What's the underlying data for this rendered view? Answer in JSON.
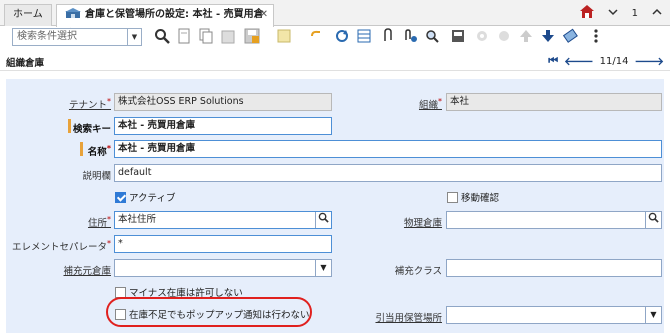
{
  "tabs": {
    "home": "ホーム",
    "active": "倉庫と保管場所の設定: 本社 - 売買用倉庫",
    "close": "✕"
  },
  "topright": {
    "count": "1",
    "menu": "⋮"
  },
  "toolbar": {
    "search_placeholder": "検索条件選択"
  },
  "section": {
    "title": "組織倉庫",
    "record_nav": "11/14"
  },
  "form": {
    "tenant_label": "テナント",
    "tenant_value": "株式会社OSS ERP Solutions",
    "org_label": "組織",
    "org_value": "本社",
    "searchkey_label": "検索キー",
    "searchkey_value": "本社 - 売買用倉庫",
    "name_label": "名称",
    "name_value": "本社 - 売買用倉庫",
    "desc_label": "説明欄",
    "desc_value": "default",
    "active_label": "アクティブ",
    "intransit_label": "移動確認",
    "address_label": "住所",
    "address_value": "本社住所",
    "physwh_label": "物理倉庫",
    "physwh_value": "",
    "separator_label": "エレメントセパレータ",
    "separator_value": "*",
    "replwh_label": "補充元倉庫",
    "replwh_value": "",
    "replclass_label": "補充クラス",
    "replclass_value": "",
    "negstock_label": "マイナス在庫は許可しない",
    "popup_label": "在庫不足でもポップアップ通知は行わない",
    "reserve_label": "引当用保管場所",
    "reserve_value": ""
  },
  "colors": {
    "highlight_ring": "#e0201e",
    "form_bg": "#e6eefb",
    "accent": "#1d4a8c"
  }
}
